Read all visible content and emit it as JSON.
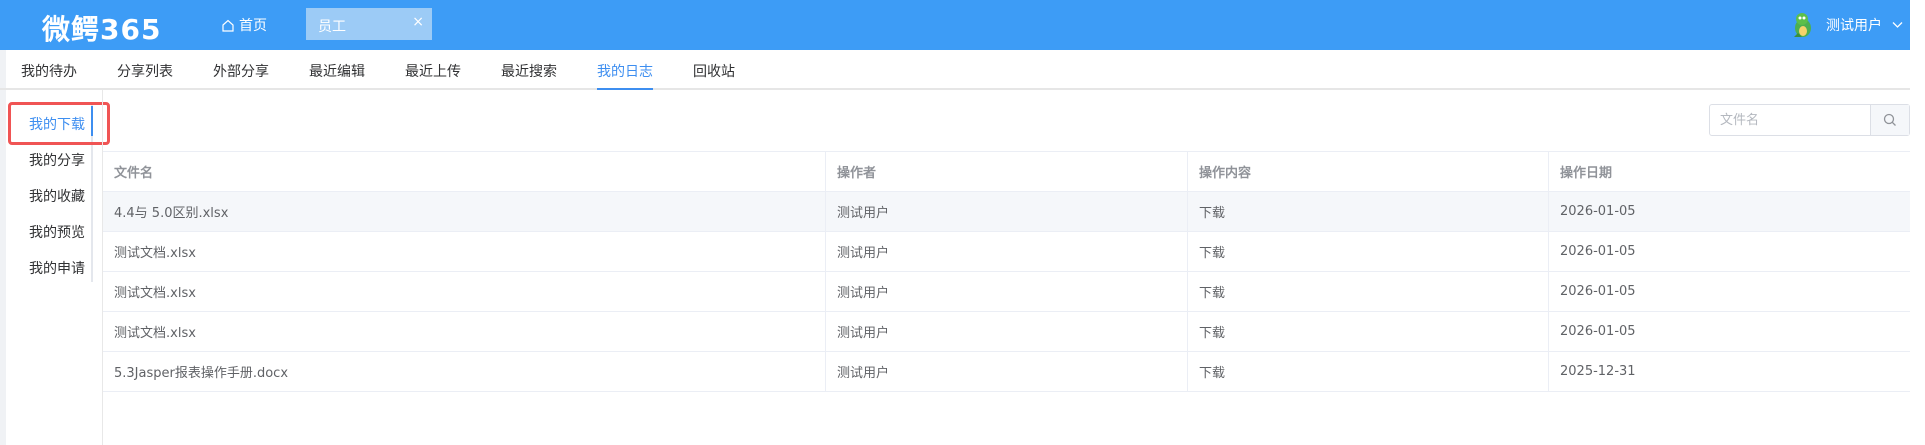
{
  "header": {
    "logo": "微鳄365",
    "home_label": "首页",
    "tab_label": "员工",
    "tab_close": "×",
    "username": "测试用户",
    "brand_color": "#3d9cf6"
  },
  "nav": {
    "items": [
      {
        "label": "我的待办"
      },
      {
        "label": "分享列表"
      },
      {
        "label": "外部分享"
      },
      {
        "label": "最近编辑"
      },
      {
        "label": "最近上传"
      },
      {
        "label": "最近搜索"
      },
      {
        "label": "我的日志",
        "active": true
      },
      {
        "label": "回收站"
      }
    ]
  },
  "side_menu": {
    "items": [
      {
        "label": "我的下载",
        "active": true
      },
      {
        "label": "我的分享"
      },
      {
        "label": "我的收藏"
      },
      {
        "label": "我的预览"
      },
      {
        "label": "我的申请"
      }
    ]
  },
  "search": {
    "placeholder": "文件名",
    "icon": "search-icon"
  },
  "table": {
    "columns": [
      "文件名",
      "操作者",
      "操作内容",
      "操作日期"
    ],
    "rows": [
      [
        "4.4与 5.0区别.xlsx",
        "测试用户",
        "下载",
        "2026-01-05"
      ],
      [
        "测试文档.xlsx",
        "测试用户",
        "下载",
        "2026-01-05"
      ],
      [
        "测试文档.xlsx",
        "测试用户",
        "下载",
        "2026-01-05"
      ],
      [
        "测试文档.xlsx",
        "测试用户",
        "下载",
        "2026-01-05"
      ],
      [
        "5.3Jasper报表操作手册.docx",
        "测试用户",
        "下载",
        "2025-12-31"
      ]
    ]
  },
  "colors": {
    "accent": "#3d8ef0",
    "highlight_border": "#f05454"
  }
}
